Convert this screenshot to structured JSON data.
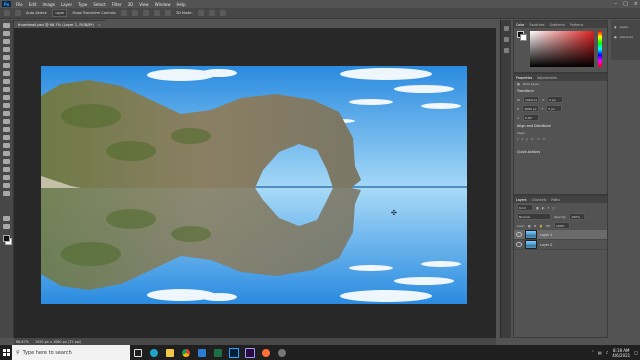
{
  "menubar": {
    "logo": "Ps",
    "items": [
      "File",
      "Edit",
      "Image",
      "Layer",
      "Type",
      "Select",
      "Filter",
      "3D",
      "View",
      "Window",
      "Help"
    ]
  },
  "options": {
    "auto_select_label": "Auto-Select:",
    "auto_select_value": "Layer",
    "transform_label": "Show Transform Controls",
    "mode_label": "3D Mode:"
  },
  "document": {
    "tab_title": "thumbnail.psd @ 66.7% (Layer 1, RGB/8*)",
    "zoom": "66.67%",
    "dims": "1920 px x 1080 px (72 ppi)"
  },
  "color_panel": {
    "tabs": [
      "Color",
      "Swatches",
      "Gradients",
      "Patterns"
    ]
  },
  "learn_panel": {
    "items": [
      "Learn",
      "Libraries"
    ]
  },
  "properties_panel": {
    "tabs": [
      "Properties",
      "Adjustments"
    ],
    "kind": "Pixel Layer",
    "transform_title": "Transform",
    "w_value": "1920 px",
    "h_value": "1080 px",
    "x_value": "0 px",
    "y_value": "0 px",
    "angle_value": "0.00°",
    "align_title": "Align and Distribute",
    "align_sub": "Align:",
    "quick_actions": "Quick Actions"
  },
  "layers_panel": {
    "tabs": [
      "Layers",
      "Channels",
      "Paths"
    ],
    "filter_label": "Kind",
    "blend_mode": "Normal",
    "opacity_label": "Opacity:",
    "opacity_value": "100%",
    "lock_label": "Lock:",
    "fill_label": "Fill:",
    "fill_value": "100%",
    "layers": [
      {
        "name": "Layer 1",
        "selected": true
      },
      {
        "name": "Layer 0",
        "selected": false
      }
    ]
  },
  "taskbar": {
    "search_placeholder": "Type here to search",
    "time": "8:18 AM",
    "date": "4/6/2021",
    "apps": [
      "task-view",
      "edge",
      "file-explorer",
      "chrome",
      "mail",
      "excel",
      "photoshop",
      "premiere",
      "firefox",
      "settings"
    ]
  },
  "colors": {
    "sky_top": "#2e8fe0",
    "sky_horizon": "#9fd6f6",
    "rock": "#7d7456",
    "moss": "#4e6a2a",
    "ps_blue": "#31a8ff"
  }
}
